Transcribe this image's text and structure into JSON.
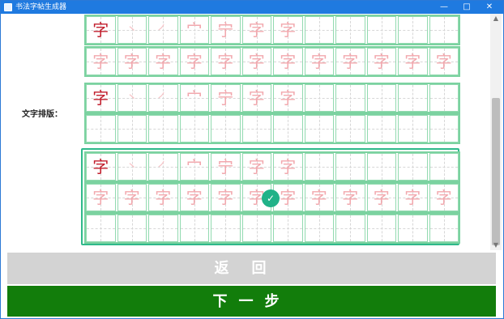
{
  "window": {
    "title": "书法字帖生成器",
    "minimize": "—",
    "maximize": "□",
    "close": "✕"
  },
  "layout_section": {
    "label": "文字排版："
  },
  "glyphs": {
    "main": "字",
    "s1": "丶",
    "s2": "㇒",
    "s3": "宀",
    "s4": "宁",
    "s5": "字",
    "s6": "字",
    "full": "字"
  },
  "buttons": {
    "back": "返回",
    "next": "下一步"
  },
  "selection": {
    "check_icon": "✓"
  }
}
